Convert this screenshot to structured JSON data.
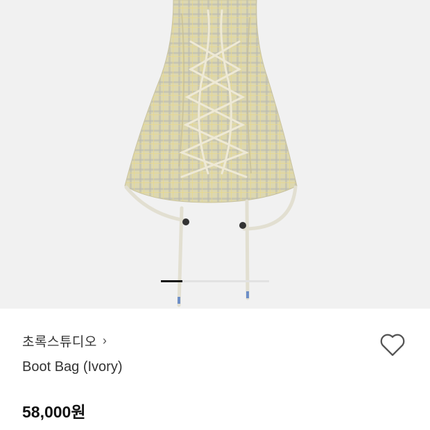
{
  "product": {
    "brand": "초록스튜디오",
    "brand_chevron": "›",
    "title": "Boot Bag (Ivory)",
    "price": "58,000원"
  },
  "gallery": {
    "image_description_icon": "bag-image",
    "slide_count": 5,
    "active_slide": 1
  },
  "colors": {
    "gallery_bg": "#f1f1f1",
    "fabric": "#d9d4ad",
    "accent": "#111111"
  },
  "icons": {
    "wishlist": "heart-icon",
    "chevron": "chevron-right-icon"
  }
}
